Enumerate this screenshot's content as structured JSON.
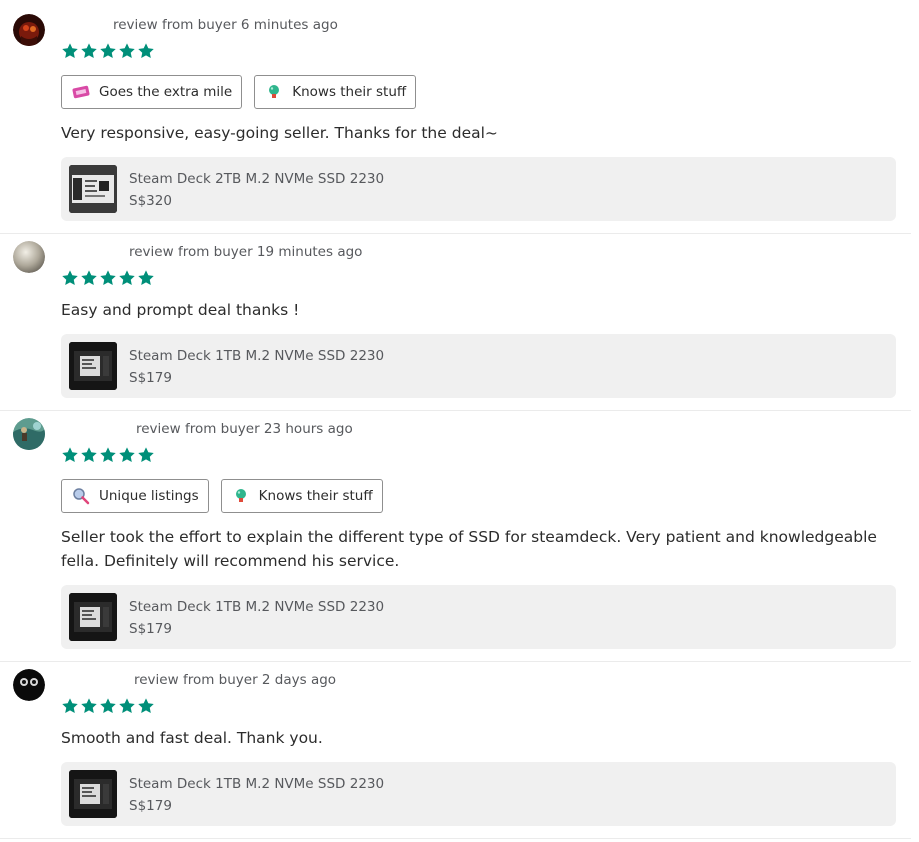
{
  "reviews": [
    {
      "header": "review from buyer 6 minutes ago",
      "rating": 5,
      "tags": [
        {
          "label": "Goes the extra mile",
          "icon": "ticket-icon"
        },
        {
          "label": "Knows their stuff",
          "icon": "lightbulb-icon"
        }
      ],
      "comment": "Very responsive, easy-going seller. Thanks for the deal~",
      "listing": {
        "title": "Steam Deck 2TB M.2 NVMe SSD 2230",
        "price": "S$320"
      }
    },
    {
      "header": "review from buyer 19 minutes ago",
      "rating": 5,
      "tags": [],
      "comment": "Easy and prompt deal thanks !",
      "listing": {
        "title": "Steam Deck 1TB M.2 NVMe SSD 2230",
        "price": "S$179"
      }
    },
    {
      "header": "review from buyer 23 hours ago",
      "rating": 5,
      "tags": [
        {
          "label": "Unique listings",
          "icon": "magnifier-icon"
        },
        {
          "label": "Knows their stuff",
          "icon": "lightbulb-icon"
        }
      ],
      "comment": "Seller took the effort to explain the different type of SSD for steamdeck. Very patient and knowledgeable fella. Definitely will recommend his service.",
      "listing": {
        "title": "Steam Deck 1TB M.2 NVMe SSD 2230",
        "price": "S$179"
      }
    },
    {
      "header": "review from buyer 2 days ago",
      "rating": 5,
      "tags": [],
      "comment": "Smooth and fast deal. Thank you.",
      "listing": {
        "title": "Steam Deck 1TB M.2 NVMe SSD 2230",
        "price": "S$179"
      }
    }
  ],
  "colors": {
    "star": "#008f79",
    "listing_bg": "#f0f0f0",
    "text_primary": "#2c2c2c",
    "text_secondary": "#57595d"
  }
}
